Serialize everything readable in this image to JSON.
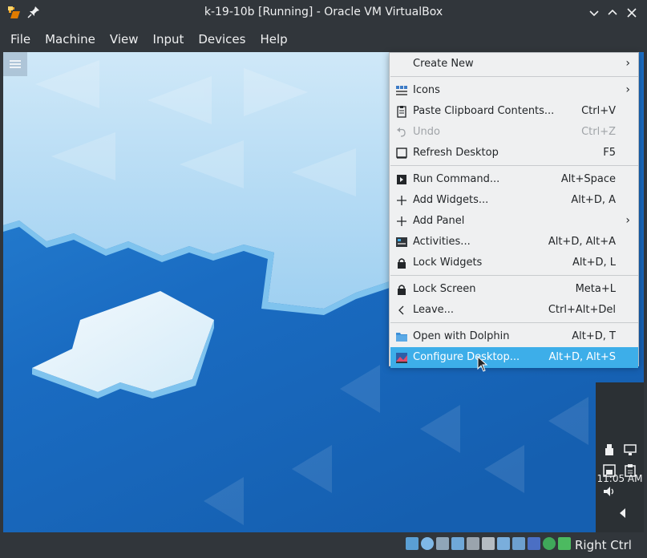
{
  "window": {
    "title": "k-19-10b [Running] - Oracle VM VirtualBox"
  },
  "menubar": {
    "items": [
      "File",
      "Machine",
      "View",
      "Input",
      "Devices",
      "Help"
    ]
  },
  "context_menu": {
    "items": [
      {
        "label": "Create New",
        "shortcut": "",
        "icon": "create-new-icon",
        "submenu": true
      },
      {
        "label": "Icons",
        "shortcut": "",
        "icon": "icons-icon",
        "submenu": true
      },
      {
        "label": "Paste Clipboard Contents...",
        "shortcut": "Ctrl+V",
        "icon": "clipboard-icon"
      },
      {
        "label": "Undo",
        "shortcut": "Ctrl+Z",
        "icon": "undo-icon",
        "disabled": true
      },
      {
        "label": "Refresh Desktop",
        "shortcut": "F5",
        "icon": "refresh-desktop-icon"
      },
      {
        "label": "Run Command...",
        "shortcut": "Alt+Space",
        "icon": "run-command-icon"
      },
      {
        "label": "Add Widgets...",
        "shortcut": "Alt+D, A",
        "icon": "plus-icon"
      },
      {
        "label": "Add Panel",
        "shortcut": "",
        "icon": "plus-icon",
        "submenu": true
      },
      {
        "label": "Activities...",
        "shortcut": "Alt+D, Alt+A",
        "icon": "activities-icon"
      },
      {
        "label": "Lock Widgets",
        "shortcut": "Alt+D, L",
        "icon": "lock-icon"
      },
      {
        "label": "Lock Screen",
        "shortcut": "Meta+L",
        "icon": "lock-icon"
      },
      {
        "label": "Leave...",
        "shortcut": "Ctrl+Alt+Del",
        "icon": "leave-icon"
      },
      {
        "label": "Open with Dolphin",
        "shortcut": "Alt+D, T",
        "icon": "folder-icon"
      },
      {
        "label": "Configure Desktop...",
        "shortcut": "Alt+D, Alt+S",
        "icon": "configure-desktop-icon",
        "active": true
      }
    ]
  },
  "panel": {
    "clock": "11:05 AM"
  },
  "statusbar": {
    "host_key": "Right Ctrl"
  },
  "colors": {
    "highlight": "#3daee9",
    "chrome": "#31363b",
    "menu_bg": "#eff0f1"
  }
}
